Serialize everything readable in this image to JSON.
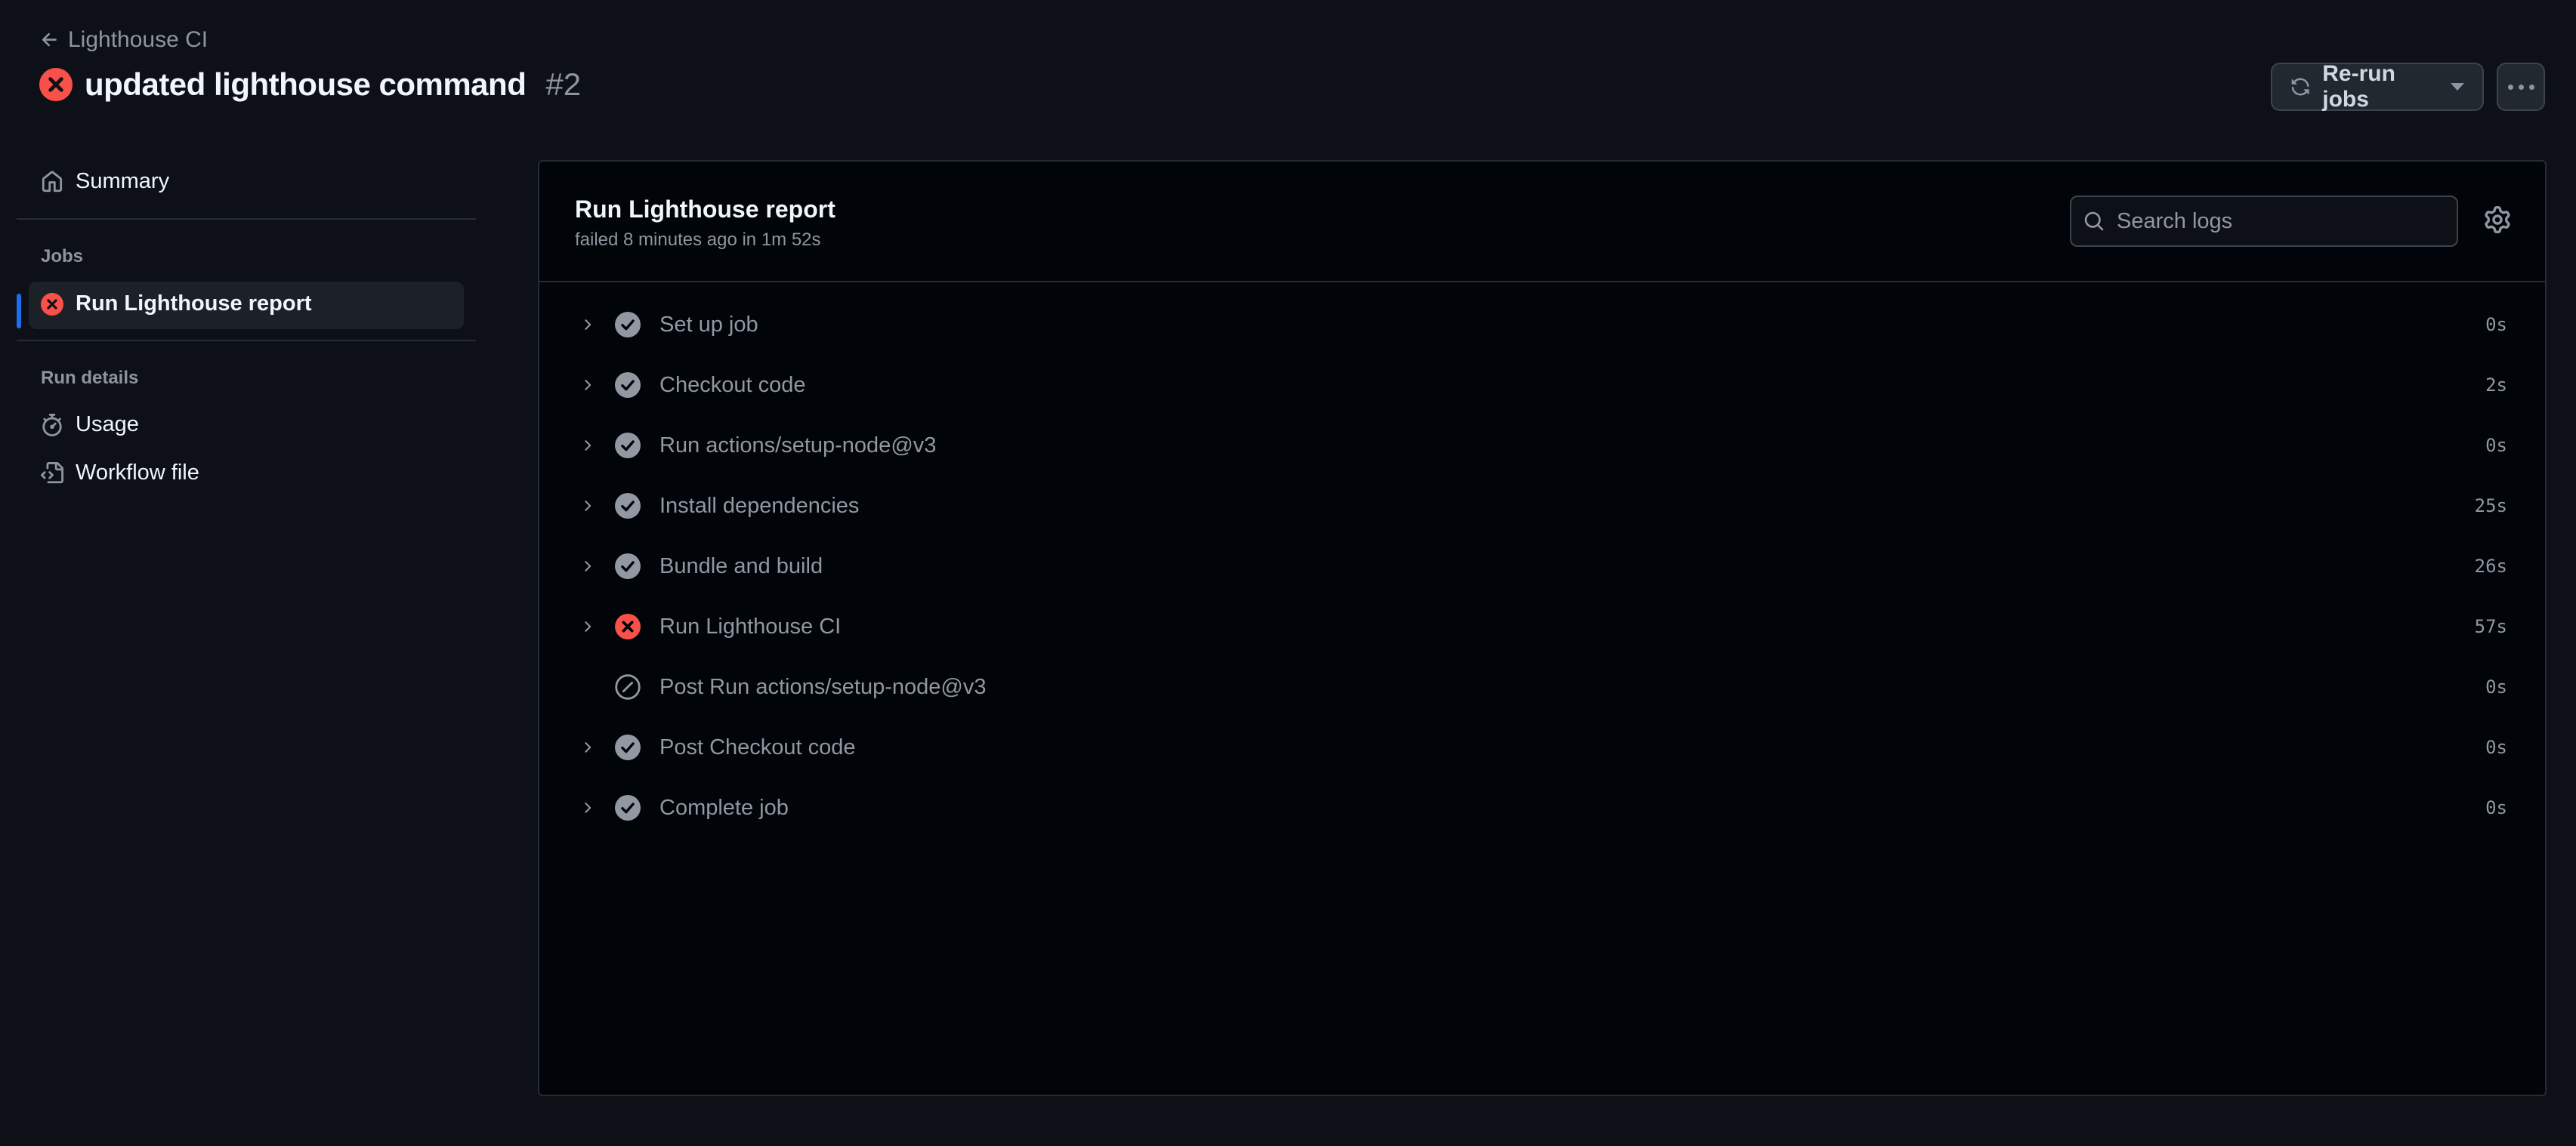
{
  "header": {
    "back_label": "Lighthouse CI",
    "title": "updated lighthouse command",
    "run_number": "#2",
    "status": "failure",
    "rerun_label": "Re-run jobs",
    "more_label": "More actions"
  },
  "sidebar": {
    "summary_label": "Summary",
    "jobs_heading": "Jobs",
    "jobs": [
      {
        "label": "Run Lighthouse report",
        "status": "failure",
        "active": true
      }
    ],
    "run_details_heading": "Run details",
    "run_details": [
      {
        "label": "Usage",
        "icon": "stopwatch-icon"
      },
      {
        "label": "Workflow file",
        "icon": "file-code-icon"
      }
    ]
  },
  "job": {
    "title": "Run Lighthouse report",
    "subtitle": "failed 8 minutes ago in 1m 52s",
    "search_placeholder": "Search logs",
    "steps": [
      {
        "name": "Set up job",
        "status": "success",
        "duration": "0s",
        "expandable": true
      },
      {
        "name": "Checkout code",
        "status": "success",
        "duration": "2s",
        "expandable": true
      },
      {
        "name": "Run actions/setup-node@v3",
        "status": "success",
        "duration": "0s",
        "expandable": true
      },
      {
        "name": "Install dependencies",
        "status": "success",
        "duration": "25s",
        "expandable": true
      },
      {
        "name": "Bundle and build",
        "status": "success",
        "duration": "26s",
        "expandable": true
      },
      {
        "name": "Run Lighthouse CI",
        "status": "failure",
        "duration": "57s",
        "expandable": true
      },
      {
        "name": "Post Run actions/setup-node@v3",
        "status": "skipped",
        "duration": "0s",
        "expandable": false
      },
      {
        "name": "Post Checkout code",
        "status": "success",
        "duration": "0s",
        "expandable": true
      },
      {
        "name": "Complete job",
        "status": "success",
        "duration": "0s",
        "expandable": true
      }
    ]
  },
  "colors": {
    "failure": "#f85149",
    "success_icon": "#9198a1",
    "accent": "#1f6feb"
  }
}
